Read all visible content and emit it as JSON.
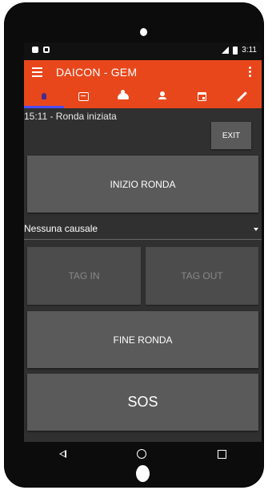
{
  "status_bar": {
    "time": "3:11",
    "network": "LTE"
  },
  "app_bar": {
    "title": "DAICON - GEM"
  },
  "tabs": [
    {
      "icon": "user-icon",
      "active": true
    },
    {
      "icon": "chat-icon",
      "active": false
    },
    {
      "icon": "group-icon",
      "active": false
    },
    {
      "icon": "person-icon",
      "active": false
    },
    {
      "icon": "calendar-icon",
      "active": false
    },
    {
      "icon": "pencil-icon",
      "active": false
    }
  ],
  "main": {
    "status_message": "15:11 - Ronda iniziata",
    "exit_label": "EXIT",
    "start_round_label": "INIZIO RONDA",
    "reason_selected": "Nessuna causale",
    "tag_in_label": "TAG IN",
    "tag_out_label": "TAG OUT",
    "end_round_label": "FINE RONDA",
    "sos_label": "SOS"
  },
  "colors": {
    "accent": "#e8471c",
    "tab_indicator": "#4d4dff",
    "background": "#303030",
    "button": "#5a5a5a"
  }
}
